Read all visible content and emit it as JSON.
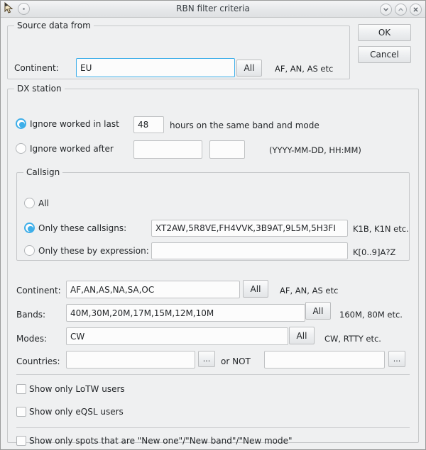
{
  "window": {
    "title": "RBN filter criteria",
    "icons": {
      "app": "cursor-icon",
      "menu": "window-menu-icon",
      "minimize": "chevron-down-icon",
      "maximize": "chevron-up-icon",
      "close": "close-icon"
    }
  },
  "actions": {
    "ok_label": "OK",
    "cancel_label": "Cancel"
  },
  "source_group": {
    "title": "Source data from",
    "continent_label": "Continent:",
    "continent_value": "EU",
    "continent_placeholder": "",
    "all_label": "All",
    "hint": "AF, AN, AS etc"
  },
  "dx_group": {
    "title": "DX station",
    "ignore_last_label": "Ignore worked in last",
    "ignore_last_hours": "48",
    "ignore_last_suffix": "hours on the same band and mode",
    "ignore_after_label": "Ignore worked after",
    "ignore_after_date": "",
    "ignore_after_time": "",
    "ignore_after_hint": "(YYYY-MM-DD, HH:MM)",
    "callsign_group": {
      "title": "Callsign",
      "all_label": "All",
      "only_these_label": "Only these callsigns:",
      "only_these_value": "XT2AW,5R8VE,FH4VVK,3B9AT,9L5M,5H3FI",
      "only_these_hint": "K1B, K1N etc.",
      "expression_label": "Only these by expression:",
      "expression_value": "",
      "expression_hint": "K[0..9]A?Z"
    },
    "rows": [
      {
        "label": "Continent:",
        "value": "AF,AN,AS,NA,SA,OC",
        "all_label": "All",
        "hint": "AF, AN, AS etc"
      },
      {
        "label": "Bands:",
        "value": "40M,30M,20M,17M,15M,12M,10M",
        "all_label": "All",
        "hint": "160M, 80M etc."
      },
      {
        "label": "Modes:",
        "value": "CW",
        "all_label": "All",
        "hint": "CW,  RTTY etc."
      }
    ],
    "countries": {
      "label": "Countries:",
      "value": "",
      "browse_label": "...",
      "or_not_label": "or NOT",
      "not_value": "",
      "not_browse_label": "..."
    },
    "checkboxes": [
      {
        "label": "Show only LoTW users",
        "checked": false
      },
      {
        "label": "Show only eQSL users",
        "checked": false
      },
      {
        "label": "Show only spots that are \"New one\"/\"New band\"/\"New mode\"",
        "checked": false
      }
    ]
  },
  "colors": {
    "accent": "#3daee9",
    "window_bg": "#eff0f1",
    "text": "#232629"
  }
}
